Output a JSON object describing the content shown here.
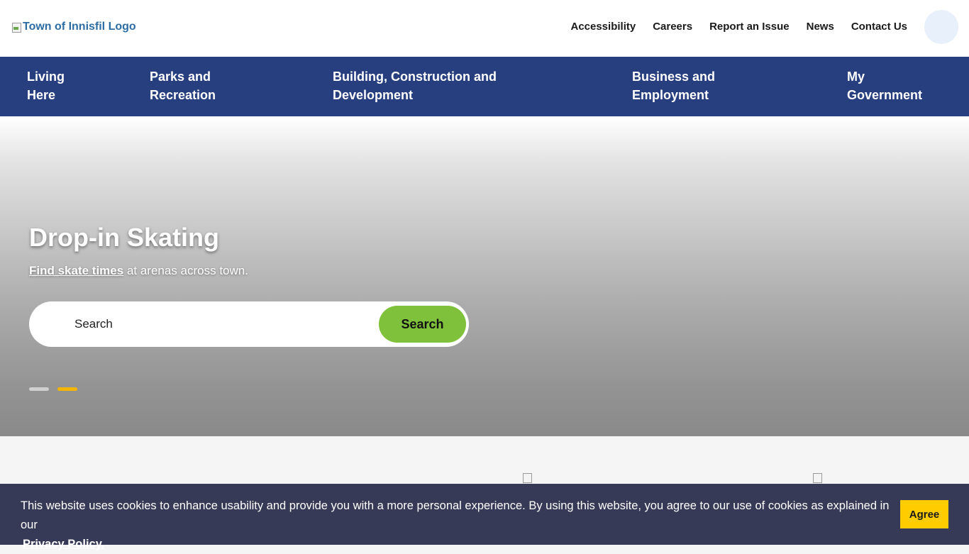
{
  "header": {
    "logo_alt": "Town of Innisfil Logo",
    "utility_nav": [
      "Accessibility",
      "Careers",
      "Report an Issue",
      "News",
      "Contact Us"
    ]
  },
  "main_nav": [
    {
      "line1": "Living",
      "line2": "Here"
    },
    {
      "line1": "Parks and",
      "line2": "Recreation"
    },
    {
      "line1": "Building, Construction and",
      "line2": "Development"
    },
    {
      "line1": "Business and",
      "line2": "Employment"
    },
    {
      "line1": "My",
      "line2": "Government"
    }
  ],
  "hero": {
    "title": "Drop-in Skating",
    "link_text": "Find skate times",
    "subtitle_rest": " at arenas across town.",
    "search_placeholder": "Search",
    "search_button": "Search",
    "slides": {
      "count": 2,
      "active_index": 1
    }
  },
  "cookie_banner": {
    "text": "This website uses cookies to enhance usability and provide you with a more personal experience. By using this website, you agree to our use of cookies as explained in our",
    "link": "Privacy Policy.",
    "button": "Agree"
  },
  "colors": {
    "nav_bg": "#273f7f",
    "search_btn": "#80c13b",
    "active_dot": "#f6b500",
    "cookie_bg": "#363a57",
    "agree_btn": "#ffcc00"
  }
}
